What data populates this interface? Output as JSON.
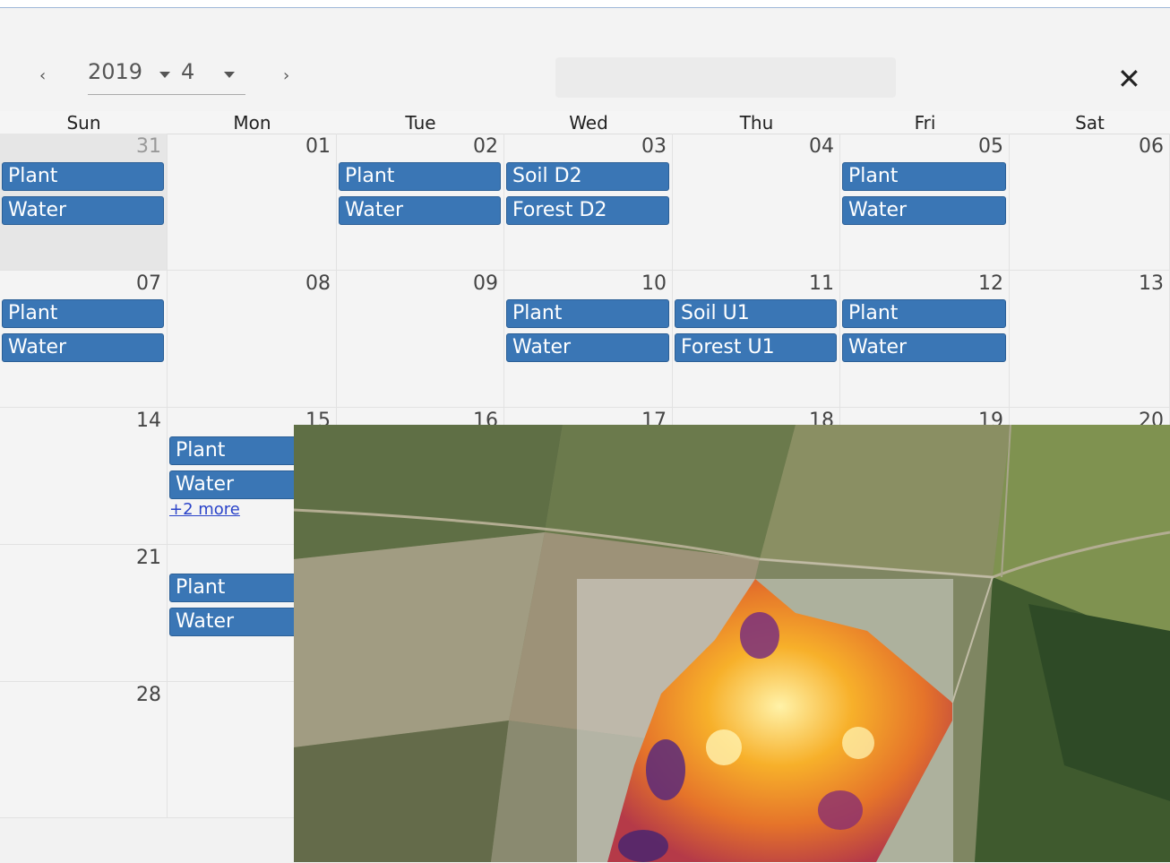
{
  "toolbar": {
    "prev_label": "‹",
    "next_label": "›",
    "year": "2019",
    "month": "4",
    "close_label": "✕"
  },
  "weekdays": [
    "Sun",
    "Mon",
    "Tue",
    "Wed",
    "Thu",
    "Fri",
    "Sat"
  ],
  "weeks": [
    {
      "days": [
        {
          "num": "31",
          "other": true,
          "events": [
            "Plant",
            "Water"
          ]
        },
        {
          "num": "01",
          "events": []
        },
        {
          "num": "02",
          "events": [
            "Plant",
            "Water"
          ]
        },
        {
          "num": "03",
          "events": [
            "Soil D2",
            "Forest D2"
          ]
        },
        {
          "num": "04",
          "events": []
        },
        {
          "num": "05",
          "events": [
            "Plant",
            "Water"
          ]
        },
        {
          "num": "06",
          "events": []
        }
      ]
    },
    {
      "days": [
        {
          "num": "07",
          "events": [
            "Plant",
            "Water"
          ]
        },
        {
          "num": "08",
          "events": []
        },
        {
          "num": "09",
          "events": []
        },
        {
          "num": "10",
          "events": [
            "Plant",
            "Water"
          ]
        },
        {
          "num": "11",
          "events": [
            "Soil U1",
            "Forest U1"
          ]
        },
        {
          "num": "12",
          "events": [
            "Plant",
            "Water"
          ]
        },
        {
          "num": "13",
          "events": []
        }
      ]
    },
    {
      "days": [
        {
          "num": "14",
          "events": []
        },
        {
          "num": "15",
          "events": [
            "Plant",
            "Water"
          ],
          "more": "+2 more"
        },
        {
          "num": "16",
          "events": []
        },
        {
          "num": "17",
          "events": []
        },
        {
          "num": "18",
          "events": []
        },
        {
          "num": "19",
          "events": []
        },
        {
          "num": "20",
          "events": []
        }
      ]
    },
    {
      "days": [
        {
          "num": "21",
          "events": []
        },
        {
          "num": "",
          "events": [
            "Plant",
            "Water"
          ]
        },
        {
          "num": "",
          "events": []
        },
        {
          "num": "",
          "events": []
        },
        {
          "num": "",
          "events": []
        },
        {
          "num": "",
          "events": []
        },
        {
          "num": "",
          "events": []
        }
      ]
    },
    {
      "days": [
        {
          "num": "28",
          "events": []
        },
        {
          "num": "",
          "events": []
        },
        {
          "num": "",
          "events": []
        },
        {
          "num": "",
          "events": []
        },
        {
          "num": "",
          "events": []
        },
        {
          "num": "",
          "events": []
        },
        {
          "num": "",
          "events": []
        }
      ]
    }
  ],
  "colors": {
    "event_bg": "#3a76b5",
    "link": "#2a43c9"
  },
  "map": {
    "description_icon": "satellite-image-overlay",
    "heatmap": "ndvi-heatmap"
  }
}
